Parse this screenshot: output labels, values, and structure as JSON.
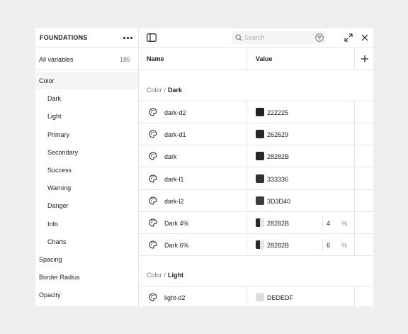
{
  "sidebar": {
    "title": "FOUNDATIONS",
    "more_icon": "more-horizontal-icon",
    "all_variables": {
      "label": "All variables",
      "count": "185"
    },
    "items": [
      {
        "label": "Color",
        "level": "top",
        "active": true
      },
      {
        "label": "Dark",
        "level": "sub"
      },
      {
        "label": "Light",
        "level": "sub"
      },
      {
        "label": "Primary",
        "level": "sub"
      },
      {
        "label": "Secondary",
        "level": "sub"
      },
      {
        "label": "Success",
        "level": "sub"
      },
      {
        "label": "Warning",
        "level": "sub"
      },
      {
        "label": "Danger",
        "level": "sub"
      },
      {
        "label": "Info",
        "level": "sub"
      },
      {
        "label": "Charts",
        "level": "sub"
      },
      {
        "label": "Spacing",
        "level": "top"
      },
      {
        "label": "Border Radius",
        "level": "top"
      },
      {
        "label": "Opacity",
        "level": "top"
      }
    ]
  },
  "toolbar": {
    "sidebar_toggle_icon": "sidebar-toggle-icon",
    "search_placeholder": "Search",
    "search_icon": "search-icon",
    "filter_icon": "filter-icon",
    "expand_icon": "expand-icon",
    "close_icon": "close-icon"
  },
  "table": {
    "columns": {
      "name": "Name",
      "value": "Value"
    },
    "add_icon": "plus-icon",
    "groups": [
      {
        "parent": "Color",
        "separator": "/",
        "name": "Dark",
        "rows": [
          {
            "name": "dark-d2",
            "hex": "222225",
            "color": "#222225"
          },
          {
            "name": "dark-d1",
            "hex": "262629",
            "color": "#262629"
          },
          {
            "name": "dark",
            "hex": "28282B",
            "color": "#28282B"
          },
          {
            "name": "dark-l1",
            "hex": "333336",
            "color": "#333336"
          },
          {
            "name": "dark-l2",
            "hex": "3D3D40",
            "color": "#3D3D40"
          },
          {
            "name": "Dark 4%",
            "hex": "28282B",
            "color": "#28282B",
            "opacity": "4",
            "unit": "%"
          },
          {
            "name": "Dark 6%",
            "hex": "28282B",
            "color": "#28282B",
            "opacity": "6",
            "unit": "%"
          }
        ]
      },
      {
        "parent": "Color",
        "separator": "/",
        "name": "Light",
        "rows": [
          {
            "name": "light-d2",
            "hex": "DEDEDF",
            "color": "#DEDEDF"
          }
        ]
      }
    ]
  }
}
